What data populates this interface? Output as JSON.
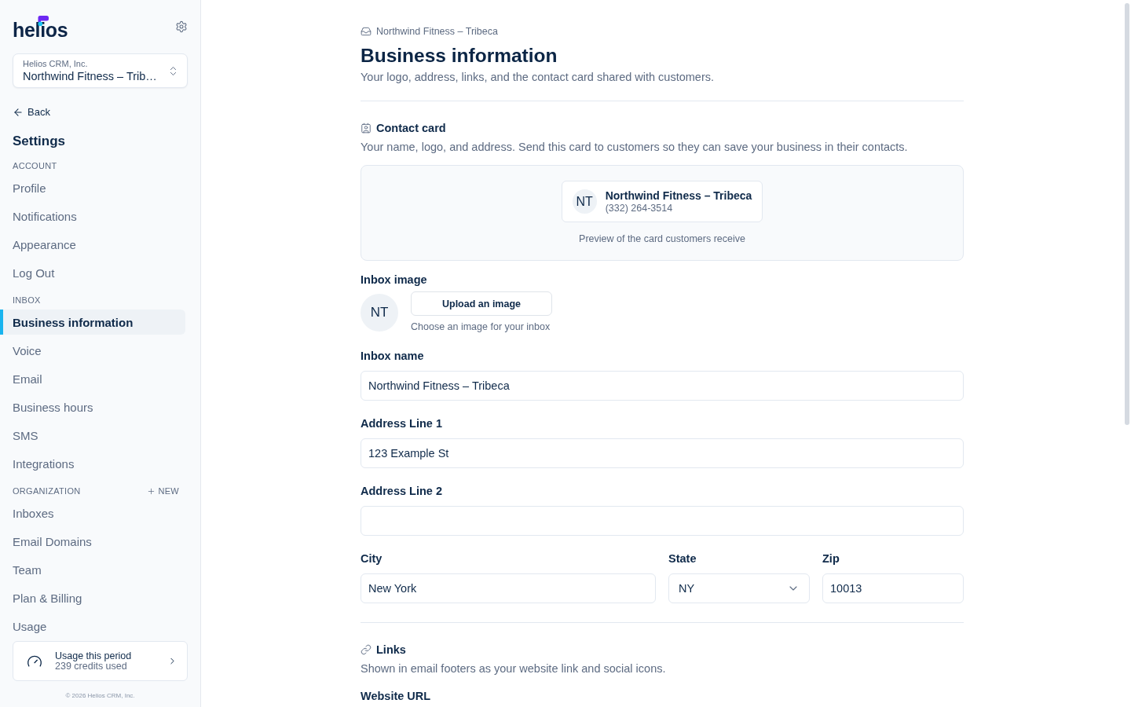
{
  "sidebar": {
    "logo": "helios",
    "workspace_switcher": {
      "organization": "Helios CRM, Inc.",
      "inbox": "Northwind Fitness – Trib…"
    },
    "back_link": "Back",
    "title": "Settings",
    "sections": [
      {
        "heading": "ACCOUNT",
        "items": [
          {
            "label": "Profile",
            "selected": false
          },
          {
            "label": "Notifications",
            "selected": false
          },
          {
            "label": "Appearance",
            "selected": false
          },
          {
            "label": "Log Out",
            "selected": false
          }
        ]
      },
      {
        "heading": "INBOX",
        "items": [
          {
            "label": "Business information",
            "selected": true
          },
          {
            "label": "Voice",
            "selected": false
          },
          {
            "label": "Email",
            "selected": false
          },
          {
            "label": "Business hours",
            "selected": false
          },
          {
            "label": "SMS",
            "selected": false
          },
          {
            "label": "Integrations",
            "selected": false
          }
        ]
      },
      {
        "heading": "ORGANIZATION",
        "action": "NEW",
        "items": [
          {
            "label": "Inboxes",
            "selected": false
          },
          {
            "label": "Email Domains",
            "selected": false
          },
          {
            "label": "Team",
            "selected": false
          },
          {
            "label": "Plan & Billing",
            "selected": false
          },
          {
            "label": "Usage",
            "selected": false
          }
        ]
      }
    ],
    "usage_card": {
      "title": "Usage this period",
      "detail": "239 credits used"
    },
    "footer": "© 2026 Helios CRM, Inc."
  },
  "page": {
    "breadcrumb": "Northwind Fitness – Tribeca",
    "title": "Business information",
    "subtitle": "Your logo, address, links, and the contact card shared with customers.",
    "contact_card": {
      "heading": "Contact card",
      "description": "Your name, logo, and address. Send this card to customers so they can save your business in their contacts.",
      "preview": {
        "initials": "NT",
        "name": "Northwind Fitness – Tribeca",
        "phone": "(332) 264-3514",
        "caption": "Preview of the card customers receive"
      }
    },
    "inbox_image": {
      "label": "Inbox image",
      "initials": "NT",
      "button": "Upload an image",
      "hint": "Choose an image for your inbox"
    },
    "fields": [
      {
        "label": "Inbox name",
        "value": "Northwind Fitness – Tribeca"
      },
      {
        "label": "Address Line 1",
        "value": "123 Example St"
      },
      {
        "label": "Address Line 2"
      }
    ],
    "location_fields": [
      {
        "kind": "text",
        "label": "City",
        "value": "New York"
      },
      {
        "kind": "select",
        "label": "State",
        "value": "NY"
      },
      {
        "kind": "text",
        "label": "Zip",
        "value": "10013"
      }
    ],
    "links": {
      "heading": "Links",
      "description": "Shown in email footers as your website link and social icons.",
      "field_label": "Website URL"
    }
  }
}
